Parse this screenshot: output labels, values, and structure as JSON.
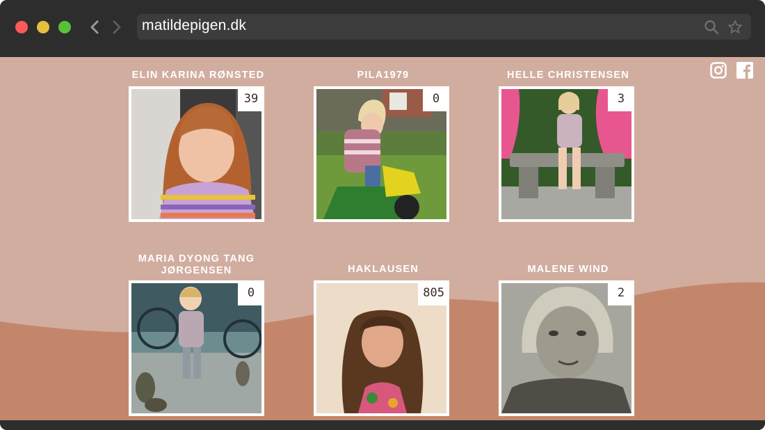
{
  "browser": {
    "url": "matildepigen.dk",
    "traffic_lights": [
      "close",
      "minimize",
      "zoom"
    ],
    "colors": {
      "chrome": "#2d2d2d",
      "urlbar": "#3c3c3c",
      "close": "#fc5b57",
      "minimize": "#e5bf3c",
      "zoom": "#57c038"
    }
  },
  "page": {
    "colors": {
      "background": "#d1ada0",
      "wave": "#c4866a",
      "name_text": "#ffffff"
    },
    "social": [
      {
        "name": "instagram",
        "icon": "instagram-icon"
      },
      {
        "name": "facebook",
        "icon": "facebook-icon"
      }
    ],
    "entries": [
      {
        "name": "ELIN KARINA RØNSTED",
        "count": "39"
      },
      {
        "name": "PILA1979",
        "count": "0"
      },
      {
        "name": "HELLE CHRISTENSEN",
        "count": "3"
      },
      {
        "name": "MARIA DYONG TANG JØRGENSEN",
        "count": "0"
      },
      {
        "name": "HAKLAUSEN",
        "count": "805"
      },
      {
        "name": "MALENE WIND",
        "count": "2"
      }
    ]
  }
}
